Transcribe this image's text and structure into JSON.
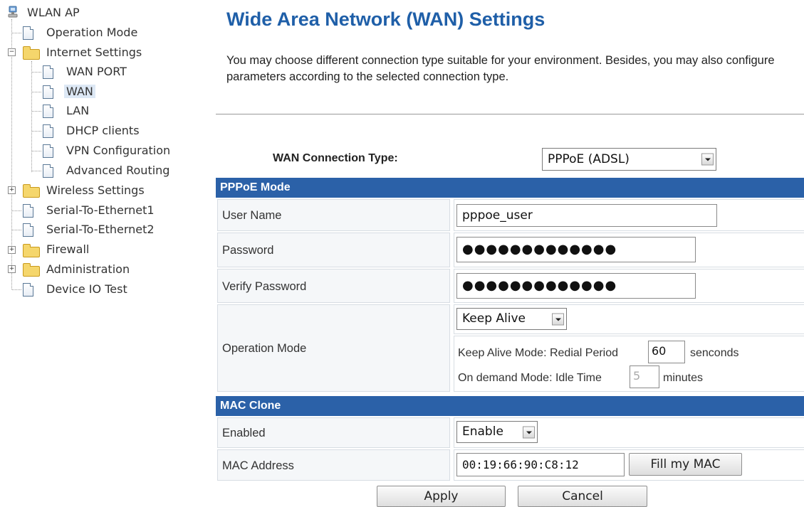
{
  "tree": {
    "root": "WLAN AP",
    "items": [
      {
        "label": "Operation Mode"
      },
      {
        "label": "Internet Settings"
      },
      {
        "label": "WAN PORT"
      },
      {
        "label": "WAN"
      },
      {
        "label": "LAN"
      },
      {
        "label": "DHCP clients"
      },
      {
        "label": "VPN Configuration"
      },
      {
        "label": "Advanced Routing"
      },
      {
        "label": "Wireless Settings"
      },
      {
        "label": "Serial-To-Ethernet1"
      },
      {
        "label": "Serial-To-Ethernet2"
      },
      {
        "label": "Firewall"
      },
      {
        "label": "Administration"
      },
      {
        "label": "Device IO Test"
      }
    ]
  },
  "page": {
    "title": "Wide Area Network (WAN) Settings",
    "description": "You may choose different connection type suitable for your environment. Besides, you may also configure parameters according to the selected connection type."
  },
  "connection": {
    "label": "WAN Connection Type:",
    "value": "PPPoE (ADSL)"
  },
  "pppoe": {
    "header": "PPPoE Mode",
    "username_label": "User Name",
    "username_value": "pppoe_user",
    "password_label": "Password",
    "password_value": "●●●●●●●●●●●●●",
    "verify_label": "Verify Password",
    "verify_value": "●●●●●●●●●●●●●",
    "opmode_label": "Operation Mode",
    "opmode_value": "Keep Alive",
    "keepalive_label": "Keep Alive Mode: Redial Period",
    "keepalive_value": "60",
    "keepalive_unit": "senconds",
    "ondemand_label": "On demand Mode: Idle Time",
    "ondemand_value": "5",
    "ondemand_unit": "minutes"
  },
  "mac": {
    "header": "MAC Clone",
    "enabled_label": "Enabled",
    "enabled_value": "Enable",
    "address_label": "MAC Address",
    "address_value": "00:19:66:90:C8:12",
    "fill_button": "Fill my MAC"
  },
  "actions": {
    "apply": "Apply",
    "cancel": "Cancel"
  }
}
